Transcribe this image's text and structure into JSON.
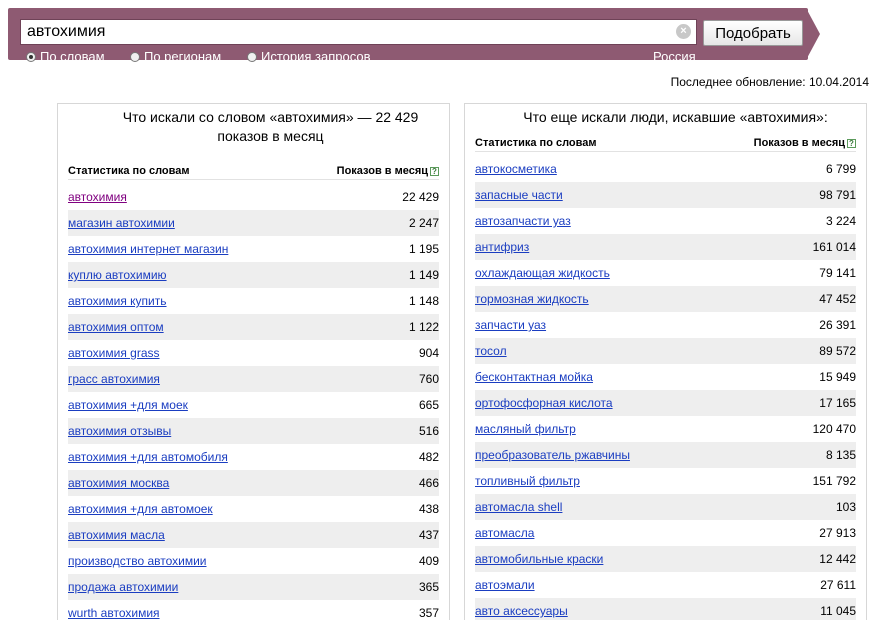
{
  "search": {
    "query": "автохимия",
    "clear_symbol": "×",
    "submit_label": "Подобрать",
    "modes": [
      {
        "label": "По словам",
        "selected": true
      },
      {
        "label": "По регионам",
        "selected": false
      },
      {
        "label": "История запросов",
        "selected": false
      }
    ],
    "region": "Россия"
  },
  "update": {
    "label": "Последнее обновление:",
    "date": "10.04.2014"
  },
  "left": {
    "title": "Что искали со словом «автохимия» — 22 429 показов в месяц",
    "col_words": "Статистика по словам",
    "col_shows": "Показов в месяц",
    "help": "?",
    "rows": [
      {
        "kw": "автохимия",
        "count": "22 429"
      },
      {
        "kw": "магазин автохимии",
        "count": "2 247"
      },
      {
        "kw": "автохимия интернет магазин",
        "count": "1 195"
      },
      {
        "kw": "куплю автохимию",
        "count": "1 149"
      },
      {
        "kw": "автохимия купить",
        "count": "1 148"
      },
      {
        "kw": "автохимия оптом",
        "count": "1 122"
      },
      {
        "kw": "автохимия grass",
        "count": "904"
      },
      {
        "kw": "грасс автохимия",
        "count": "760"
      },
      {
        "kw": "автохимия +для моек",
        "count": "665"
      },
      {
        "kw": "автохимия отзывы",
        "count": "516"
      },
      {
        "kw": "автохимия +для автомобиля",
        "count": "482"
      },
      {
        "kw": "автохимия москва",
        "count": "466"
      },
      {
        "kw": "автохимия +для автомоек",
        "count": "438"
      },
      {
        "kw": "автохимия масла",
        "count": "437"
      },
      {
        "kw": "производство автохимии",
        "count": "409"
      },
      {
        "kw": "продажа автохимии",
        "count": "365"
      },
      {
        "kw": "wurth автохимия",
        "count": "357"
      }
    ]
  },
  "right": {
    "title": "Что еще искали люди, искавшие «автохимия»:",
    "col_words": "Статистика по словам",
    "col_shows": "Показов в месяц",
    "help": "?",
    "rows": [
      {
        "kw": "автокосметика",
        "count": "6 799"
      },
      {
        "kw": "запасные части",
        "count": "98 791"
      },
      {
        "kw": "автозапчасти уаз",
        "count": "3 224"
      },
      {
        "kw": "антифриз",
        "count": "161 014"
      },
      {
        "kw": "охлаждающая жидкость",
        "count": "79 141"
      },
      {
        "kw": "тормозная жидкость",
        "count": "47 452"
      },
      {
        "kw": "запчасти уаз",
        "count": "26 391"
      },
      {
        "kw": "тосол",
        "count": "89 572"
      },
      {
        "kw": "бесконтактная мойка",
        "count": "15 949"
      },
      {
        "kw": "ортофосфорная кислота",
        "count": "17 165"
      },
      {
        "kw": "масляный фильтр",
        "count": "120 470"
      },
      {
        "kw": "преобразователь ржавчины",
        "count": "8 135"
      },
      {
        "kw": "топливный фильтр",
        "count": "151 792"
      },
      {
        "kw": "автомасла shell",
        "count": "103"
      },
      {
        "kw": "автомасла",
        "count": "27 913"
      },
      {
        "kw": "автомобильные краски",
        "count": "12 442"
      },
      {
        "kw": "автоэмали",
        "count": "27 611"
      },
      {
        "kw": "авто аксессуары",
        "count": "11 045"
      }
    ]
  }
}
